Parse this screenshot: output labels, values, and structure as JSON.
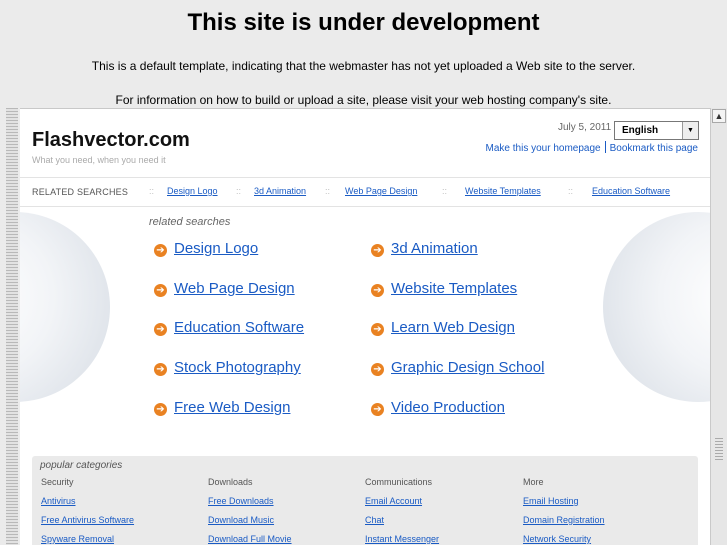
{
  "header": {
    "title": "This site is under development",
    "line1": "This is a default template, indicating that the webmaster has not yet uploaded a Web site to the server.",
    "line2": "For information on how to build or upload a site, please visit your web hosting company's site."
  },
  "site": {
    "logo": "Flashvector.com",
    "tagline": "What you need, when you need it",
    "date": "July 5, 2011",
    "language": "English",
    "make_homepage": "Make this your homepage",
    "bookmark": "Bookmark this page"
  },
  "related_bar": {
    "label": "RELATED SEARCHES",
    "separator": "::",
    "items": [
      "Design Logo",
      "3d Animation",
      "Web Page Design",
      "Website Templates",
      "Education Software"
    ]
  },
  "related_searches": {
    "title": "related searches",
    "links": [
      "Design Logo",
      "3d Animation",
      "Web Page Design",
      "Website Templates",
      "Education Software",
      "Learn Web Design",
      "Stock Photography",
      "Graphic Design School",
      "Free Web Design",
      "Video Production"
    ]
  },
  "popular": {
    "title": "popular categories",
    "columns": [
      {
        "heading": "Security",
        "links": [
          "Antivirus",
          "Free Antivirus Software",
          "Spyware Removal"
        ]
      },
      {
        "heading": "Downloads",
        "links": [
          "Free Downloads",
          "Download Music",
          "Download Full Movie"
        ]
      },
      {
        "heading": "Communications",
        "links": [
          "Email Account",
          "Chat",
          "Instant Messenger"
        ]
      },
      {
        "heading": "More",
        "links": [
          "Email Hosting",
          "Domain Registration",
          "Network Security"
        ]
      }
    ]
  },
  "icons": {
    "bullet": "arrow-circle-icon",
    "dropdown": "chevron-down-icon",
    "scroll_up": "arrow-up-icon"
  },
  "colors": {
    "link": "#1a5bc4",
    "bullet": "#e98222",
    "background": "#ebebeb"
  }
}
